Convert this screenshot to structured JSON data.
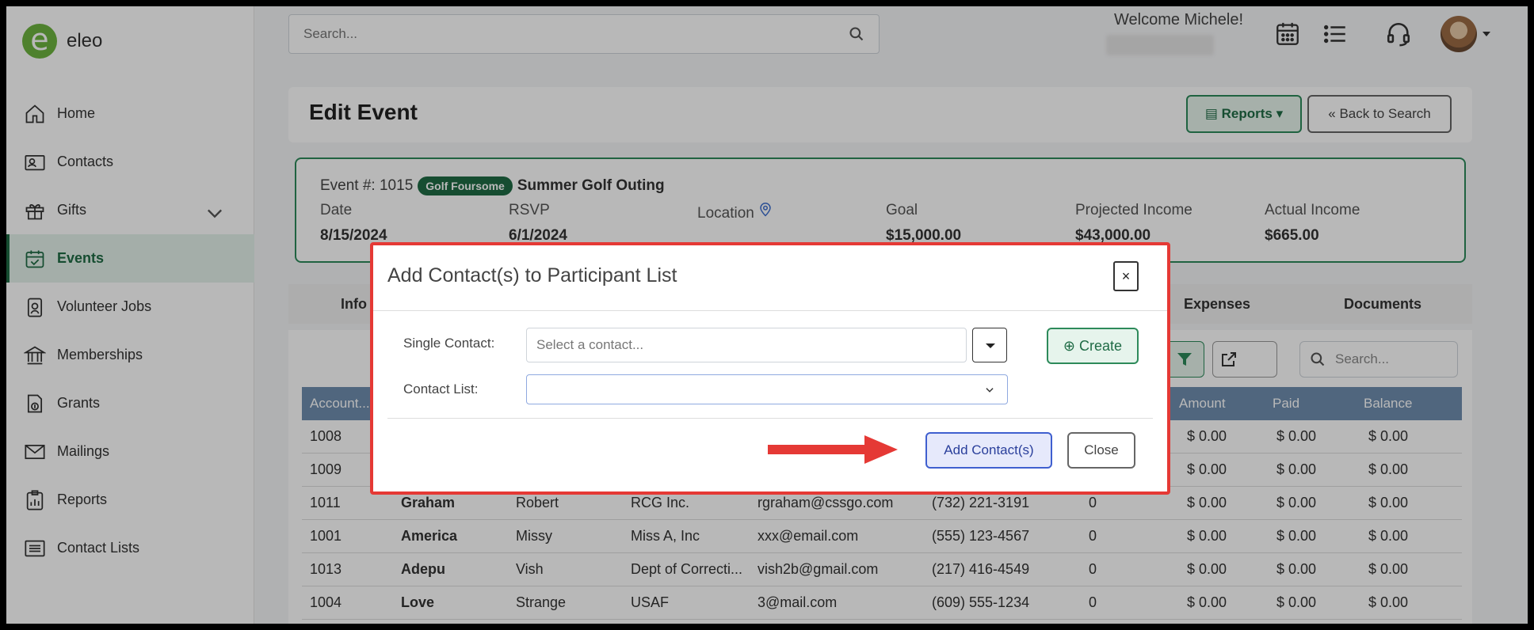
{
  "app": {
    "name": "eleo"
  },
  "sidebar": {
    "items": [
      {
        "label": "Home"
      },
      {
        "label": "Contacts"
      },
      {
        "label": "Gifts"
      },
      {
        "label": "Events"
      },
      {
        "label": "Volunteer Jobs"
      },
      {
        "label": "Memberships"
      },
      {
        "label": "Grants"
      },
      {
        "label": "Mailings"
      },
      {
        "label": "Reports"
      },
      {
        "label": "Contact Lists"
      }
    ]
  },
  "header": {
    "search_placeholder": "Search...",
    "welcome": "Welcome Michele!"
  },
  "page": {
    "title": "Edit Event",
    "reports_label": "Reports",
    "back_label": "Back to Search"
  },
  "event": {
    "number": "Event #: 1015",
    "badge": "Golf Foursome",
    "name": "Summer Golf Outing",
    "fields": [
      {
        "label": "Date",
        "value": "8/15/2024"
      },
      {
        "label": "RSVP",
        "value": "6/1/2024"
      },
      {
        "label": "Location",
        "value": ""
      },
      {
        "label": "Goal",
        "value": "$15,000.00"
      },
      {
        "label": "Projected Income",
        "value": "$43,000.00"
      },
      {
        "label": "Actual Income",
        "value": "$665.00"
      }
    ]
  },
  "tabs": {
    "info": "Info",
    "expenses": "Expenses",
    "documents": "Documents"
  },
  "table": {
    "search_placeholder": "Search...",
    "headers": {
      "account": "Account...",
      "amount": "Amount",
      "paid": "Paid",
      "balance": "Balance"
    },
    "rows": [
      {
        "account": "1008",
        "last": "",
        "first": "",
        "org": "",
        "email": "",
        "phone": "",
        "qty": "",
        "amount": "$ 0.00",
        "paid": "$ 0.00",
        "balance": "$ 0.00"
      },
      {
        "account": "1009",
        "last": "",
        "first": "",
        "org": "",
        "email": "",
        "phone": "",
        "qty": "",
        "amount": "$ 0.00",
        "paid": "$ 0.00",
        "balance": "$ 0.00"
      },
      {
        "account": "1011",
        "last": "Graham",
        "first": "Robert",
        "org": "RCG Inc.",
        "email": "rgraham@cssgo.com",
        "phone": "(732) 221-3191",
        "qty": "0",
        "amount": "$ 0.00",
        "paid": "$ 0.00",
        "balance": "$ 0.00"
      },
      {
        "account": "1001",
        "last": "America",
        "first": "Missy",
        "org": "Miss A, Inc",
        "email": "xxx@email.com",
        "phone": "(555) 123-4567",
        "qty": "0",
        "amount": "$ 0.00",
        "paid": "$ 0.00",
        "balance": "$ 0.00"
      },
      {
        "account": "1013",
        "last": "Adepu",
        "first": "Vish",
        "org": "Dept of Correcti...",
        "email": "vish2b@gmail.com",
        "phone": "(217) 416-4549",
        "qty": "0",
        "amount": "$ 0.00",
        "paid": "$ 0.00",
        "balance": "$ 0.00"
      },
      {
        "account": "1004",
        "last": "Love",
        "first": "Strange",
        "org": "USAF",
        "email": "3@mail.com",
        "phone": "(609) 555-1234",
        "qty": "0",
        "amount": "$ 0.00",
        "paid": "$ 0.00",
        "balance": "$ 0.00"
      }
    ]
  },
  "modal": {
    "title": "Add Contact(s) to Participant List",
    "close_x": "×",
    "single_label": "Single Contact:",
    "single_placeholder": "Select a contact...",
    "create_label": "Create",
    "list_label": "Contact List:",
    "add_label": "Add Contact(s)",
    "close_label": "Close",
    "annotation_color": "#e53935"
  }
}
